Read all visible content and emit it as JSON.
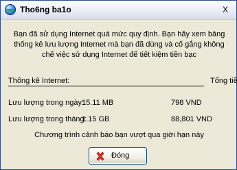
{
  "window": {
    "title": "Tho6ng ba1o",
    "close_label": "X"
  },
  "message": "Bạn đã sử dụng Internet quá mức quy định. Bạn hãy xem bảng thống kê lưu lượng Internet mà bạn đã dùng và cố gắng không chế việc sử dụng Internet để tiết kiệm tiền bạc",
  "stats": {
    "header_label": "Thống kê Internet:",
    "header_total": "Tổng tiền",
    "rows": [
      {
        "label": "Lưu lượng trong ngày:",
        "amount": "15.11 MB",
        "cost": "798 VND"
      },
      {
        "label": "Lưu lượng trong tháng:",
        "amount": "1.15 GB",
        "cost": "88,801 VND"
      }
    ]
  },
  "warning": "Chương trình cảnh báo bạn vượt qua giới hạn này",
  "button": {
    "label": "Đóng",
    "icon": "close-x-icon",
    "icon_color": "#e0322b"
  }
}
